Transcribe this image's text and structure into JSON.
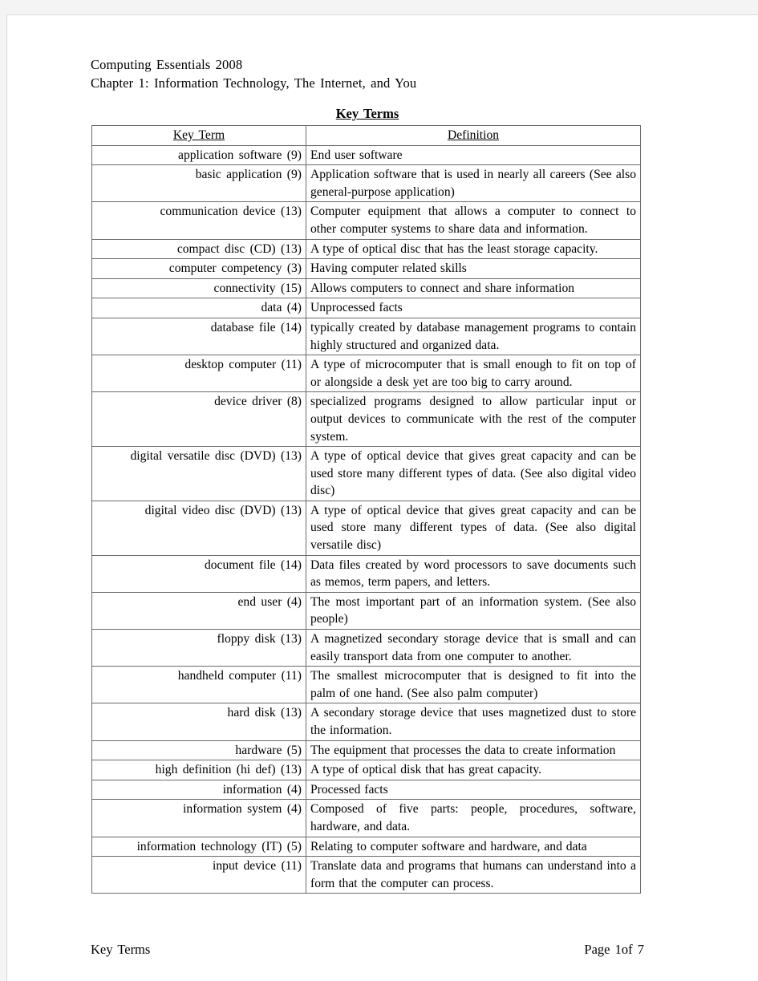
{
  "document": {
    "header_line1": "Computing Essentials 2008",
    "header_line2": "Chapter 1: Information Technology, The Internet, and You",
    "table_title": "Key Terms"
  },
  "table": {
    "columns": [
      "Key Term",
      "Definition"
    ],
    "rows": [
      {
        "term": "application software (9)",
        "definition": "End user software",
        "justify": false
      },
      {
        "term": "basic application (9)",
        "definition": "Application software that is used in nearly all careers (See also general-purpose application)",
        "justify": true
      },
      {
        "term": "communication device (13)",
        "definition": "Computer equipment that allows a computer to connect to other computer systems to share data and information.",
        "justify": true
      },
      {
        "term": "compact disc (CD) (13)",
        "definition": "A type of optical disc that has the least storage capacity.",
        "justify": false
      },
      {
        "term": "computer competency (3)",
        "definition": "Having computer related skills",
        "justify": false
      },
      {
        "term": "connectivity (15)",
        "definition": "Allows computers to connect and share information",
        "justify": false
      },
      {
        "term": "data (4)",
        "definition": "Unprocessed facts",
        "justify": false
      },
      {
        "term": "database file (14)",
        "definition": "typically created by database management programs to contain highly structured and organized data.",
        "justify": true
      },
      {
        "term": "desktop computer (11)",
        "definition": "A type of microcomputer that is small enough to fit on top of or alongside a desk yet are too big to carry around.",
        "justify": true
      },
      {
        "term": "device driver (8)",
        "definition": "specialized programs designed to allow particular input or output devices to communicate with the rest of the computer system.",
        "justify": true
      },
      {
        "term": "digital versatile disc (DVD) (13)",
        "definition": "A type of optical device that gives great capacity and can be used store many different types of data.  (See also digital video disc)",
        "justify": true
      },
      {
        "term": "digital video disc (DVD) (13)",
        "definition": "A type of optical device that gives great capacity and can be used store many different types of data.  (See also digital versatile disc)",
        "justify": true
      },
      {
        "term": "document file (14)",
        "definition": "Data files created by word processors to save documents such as memos, term papers, and letters.",
        "justify": true
      },
      {
        "term": "end user (4)",
        "definition": "The most important part of an information system. (See also people)",
        "justify": true
      },
      {
        "term": "floppy disk (13)",
        "definition": "A magnetized secondary storage device that is small and can easily transport data from one computer to another.",
        "justify": true
      },
      {
        "term": "handheld computer (11)",
        "definition": "The smallest microcomputer that is designed to fit into the palm of one hand. (See also palm computer)",
        "justify": true
      },
      {
        "term": "hard disk (13)",
        "definition": "A secondary storage device that uses magnetized dust to store the information.",
        "justify": true
      },
      {
        "term": "hardware (5)",
        "definition": "The equipment that processes the data to create information",
        "justify": false
      },
      {
        "term": "high definition (hi def) (13)",
        "definition": "A type of optical disk that has great capacity.",
        "justify": false
      },
      {
        "term": "information (4)",
        "definition": "Processed facts",
        "justify": false
      },
      {
        "term": "information system (4)",
        "definition": "Composed of five parts: people, procedures, software, hardware, and data.",
        "justify": true
      },
      {
        "term": "information technology (IT) (5)",
        "definition": "Relating to computer software and hardware, and data",
        "justify": false
      },
      {
        "term": "input device (11)",
        "definition": "Translate data and programs that humans can understand into a form that the computer can process.",
        "justify": true
      }
    ]
  },
  "footer": {
    "left": "Key Terms",
    "right": "Page 1of 7"
  }
}
